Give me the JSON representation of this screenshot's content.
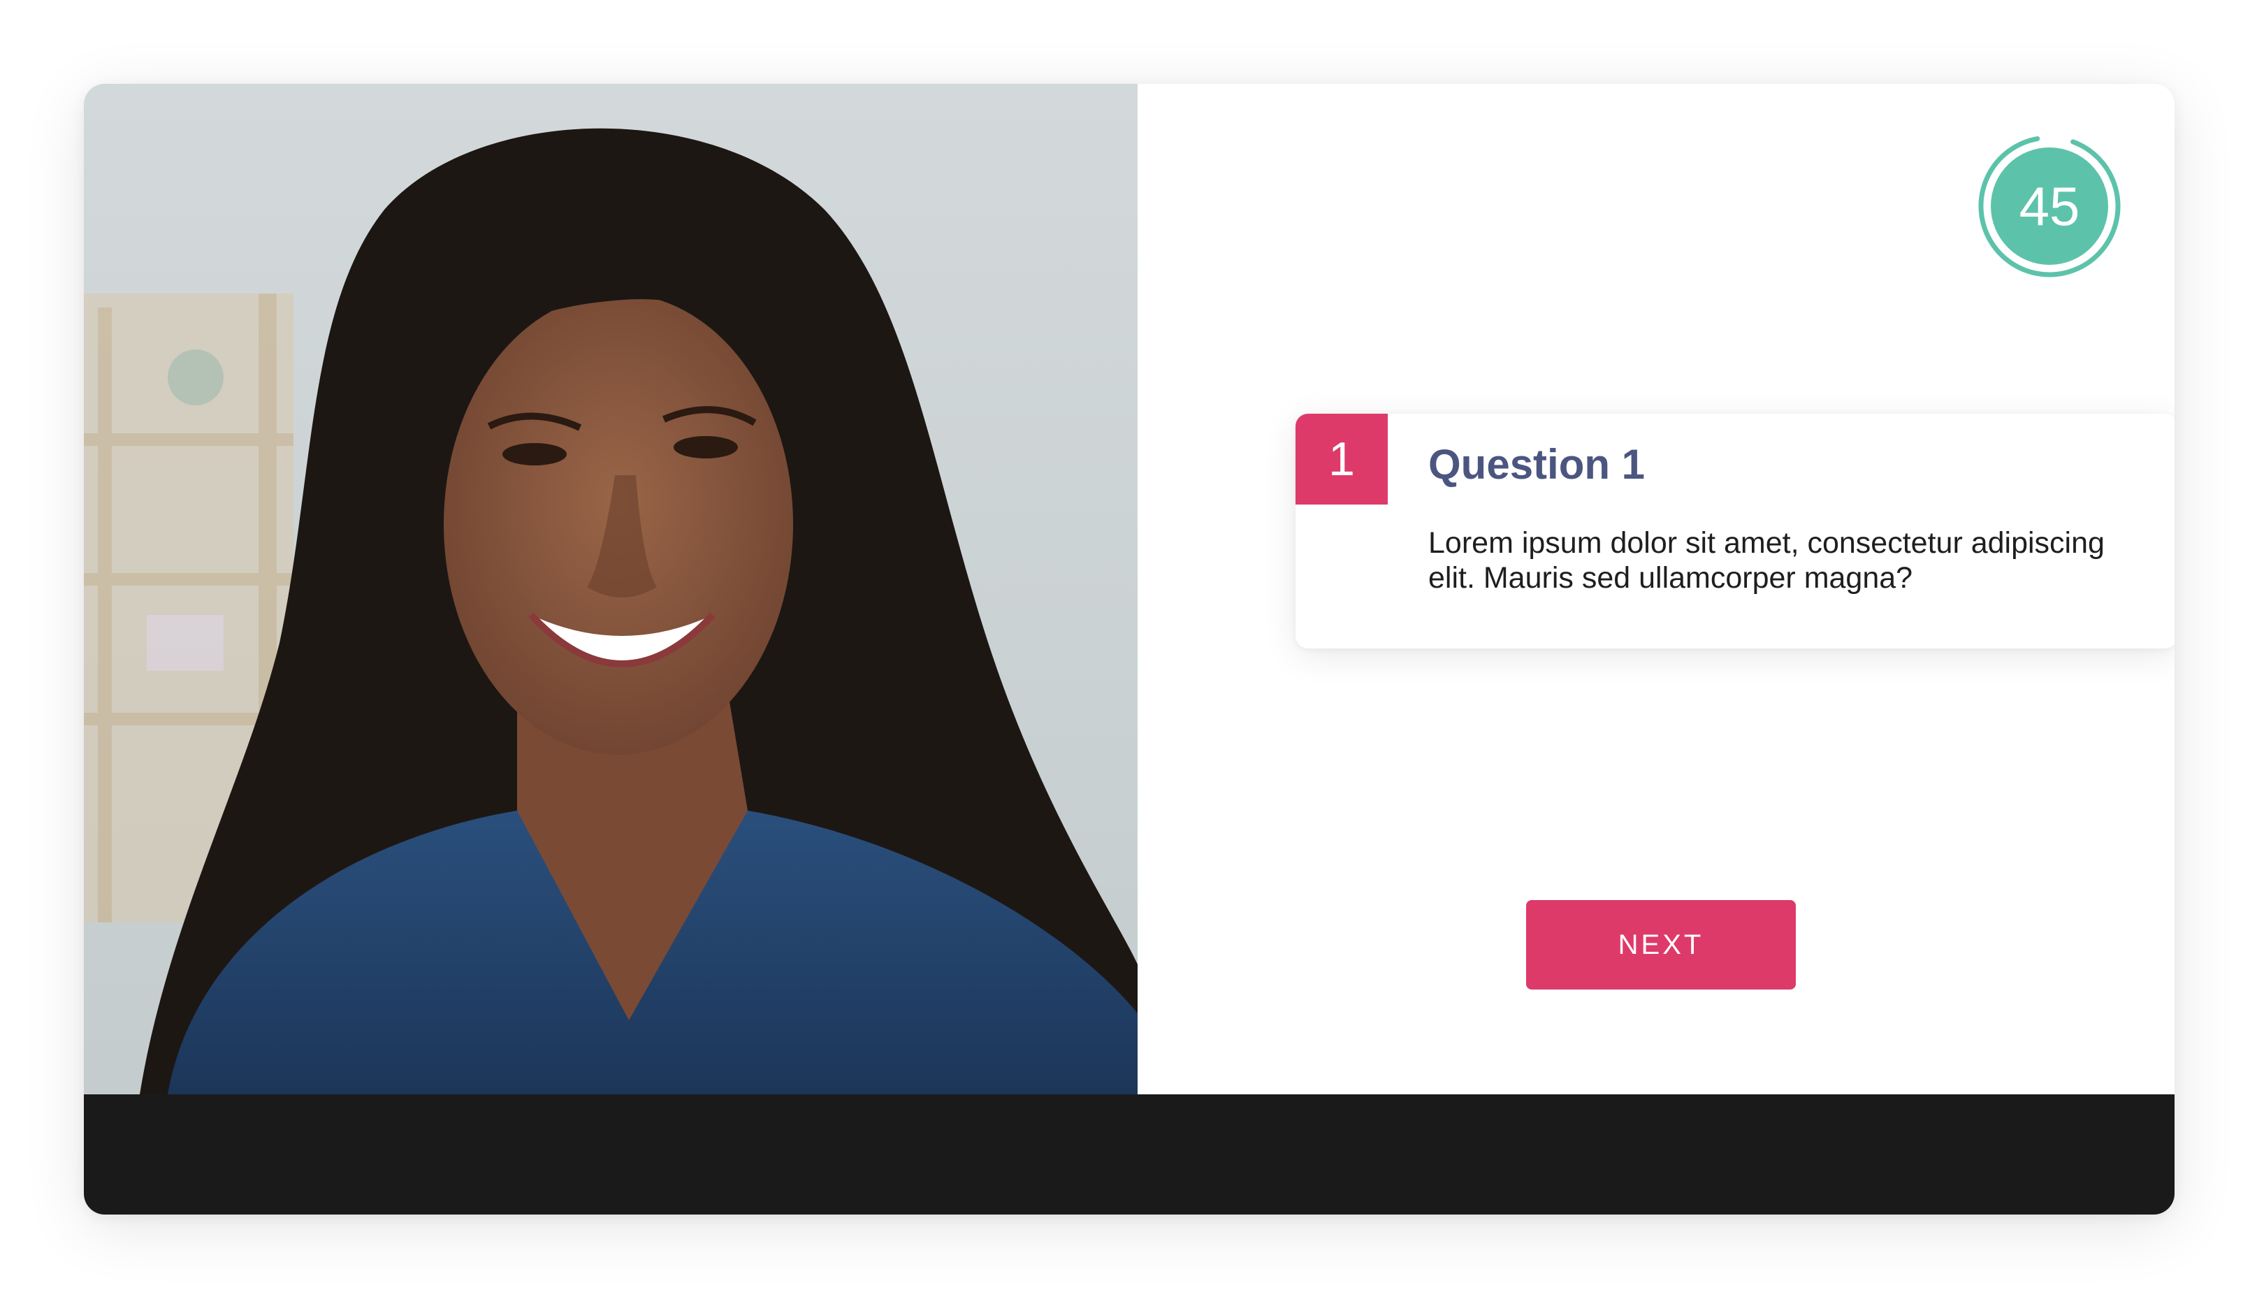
{
  "timer": {
    "value": "45",
    "remaining_fraction": 0.97,
    "color": "#5cc3aa"
  },
  "question": {
    "number": "1",
    "title": "Question 1",
    "text": "Lorem ipsum dolor sit amet, consectetur adipiscing elit. Mauris sed ullamcorper magna?"
  },
  "actions": {
    "next_label": "NEXT"
  },
  "colors": {
    "accent": "#dd3a6a",
    "title": "#4b5680",
    "bottom_bar": "#1a1a1a"
  },
  "video": {
    "subject_icon": "person-video-feed"
  }
}
